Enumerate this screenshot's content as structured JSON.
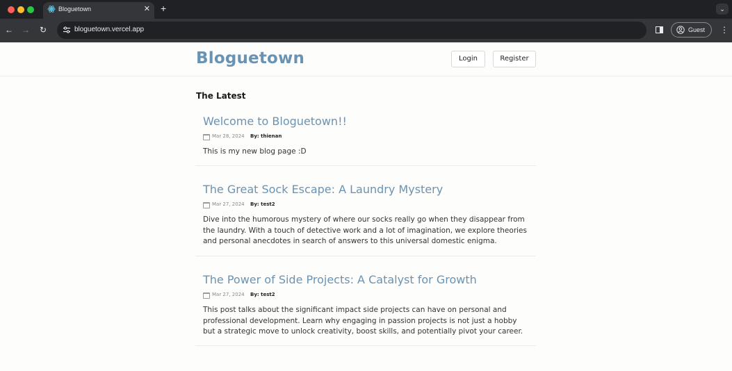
{
  "browser": {
    "tab_title": "Bloguetown",
    "url": "bloguetown.vercel.app",
    "profile_label": "Guest"
  },
  "header": {
    "brand": "Bloguetown",
    "login_label": "Login",
    "register_label": "Register"
  },
  "section_title": "The Latest",
  "posts": [
    {
      "title": "Welcome to Bloguetown!!",
      "date": "Mar 28, 2024",
      "author": "By: thienan",
      "excerpt": "This is my new blog page :D"
    },
    {
      "title": "The Great Sock Escape: A Laundry Mystery",
      "date": "Mar 27, 2024",
      "author": "By: test2",
      "excerpt": "Dive into the humorous mystery of where our socks really go when they disappear from the laundry. With a touch of detective work and a lot of imagination, we explore theories and personal anecdotes in search of answers to this universal domestic enigma."
    },
    {
      "title": "The Power of Side Projects: A Catalyst for Growth",
      "date": "Mar 27, 2024",
      "author": "By: test2",
      "excerpt": "This post talks about the significant impact side projects can have on personal and professional development. Learn why engaging in passion projects is not just a hobby but a strategic move to unlock creativity, boost skills, and potentially pivot your career."
    }
  ]
}
